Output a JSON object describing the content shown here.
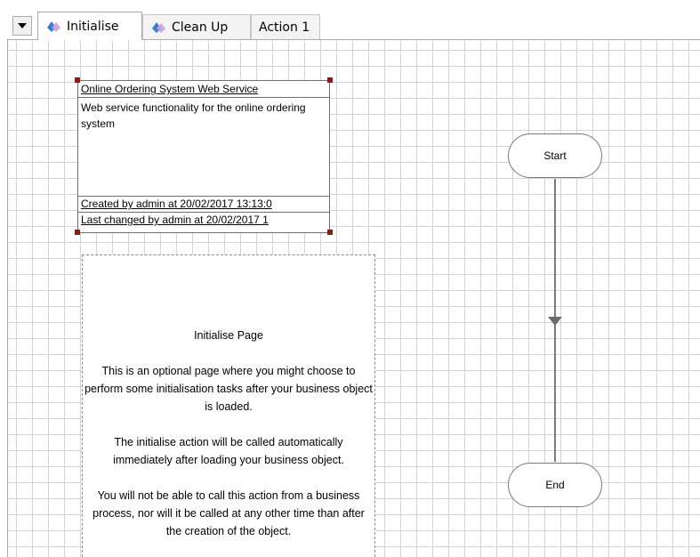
{
  "tabs": [
    {
      "label": "Initialise",
      "active": true,
      "icon": "object-icon"
    },
    {
      "label": "Clean Up",
      "active": false,
      "icon": "object-icon"
    },
    {
      "label": "Action 1",
      "active": false
    }
  ],
  "info_box": {
    "title": "Online Ordering System Web Service",
    "description": "Web service functionality for the online ordering system",
    "created": "Created  by  admin  at  20/02/2017 13:13:0",
    "changed": "Last changed by admin at 20/02/2017 1"
  },
  "note": {
    "heading": "Initialise Page",
    "para1": "This is an optional page where you might choose to perform some initialisation tasks after your business object is loaded.",
    "para2": "The initialise action will be called automatically immediately after loading your business object.",
    "para3": "You will not be able to call this action from a business process, nor will it be called at any other time than after the creation of the object."
  },
  "flow": {
    "start_label": "Start",
    "end_label": "End"
  },
  "colors": {
    "handle": "#8b1a1a",
    "grid": "#d4d4d4",
    "connector": "#7a7a7a"
  }
}
